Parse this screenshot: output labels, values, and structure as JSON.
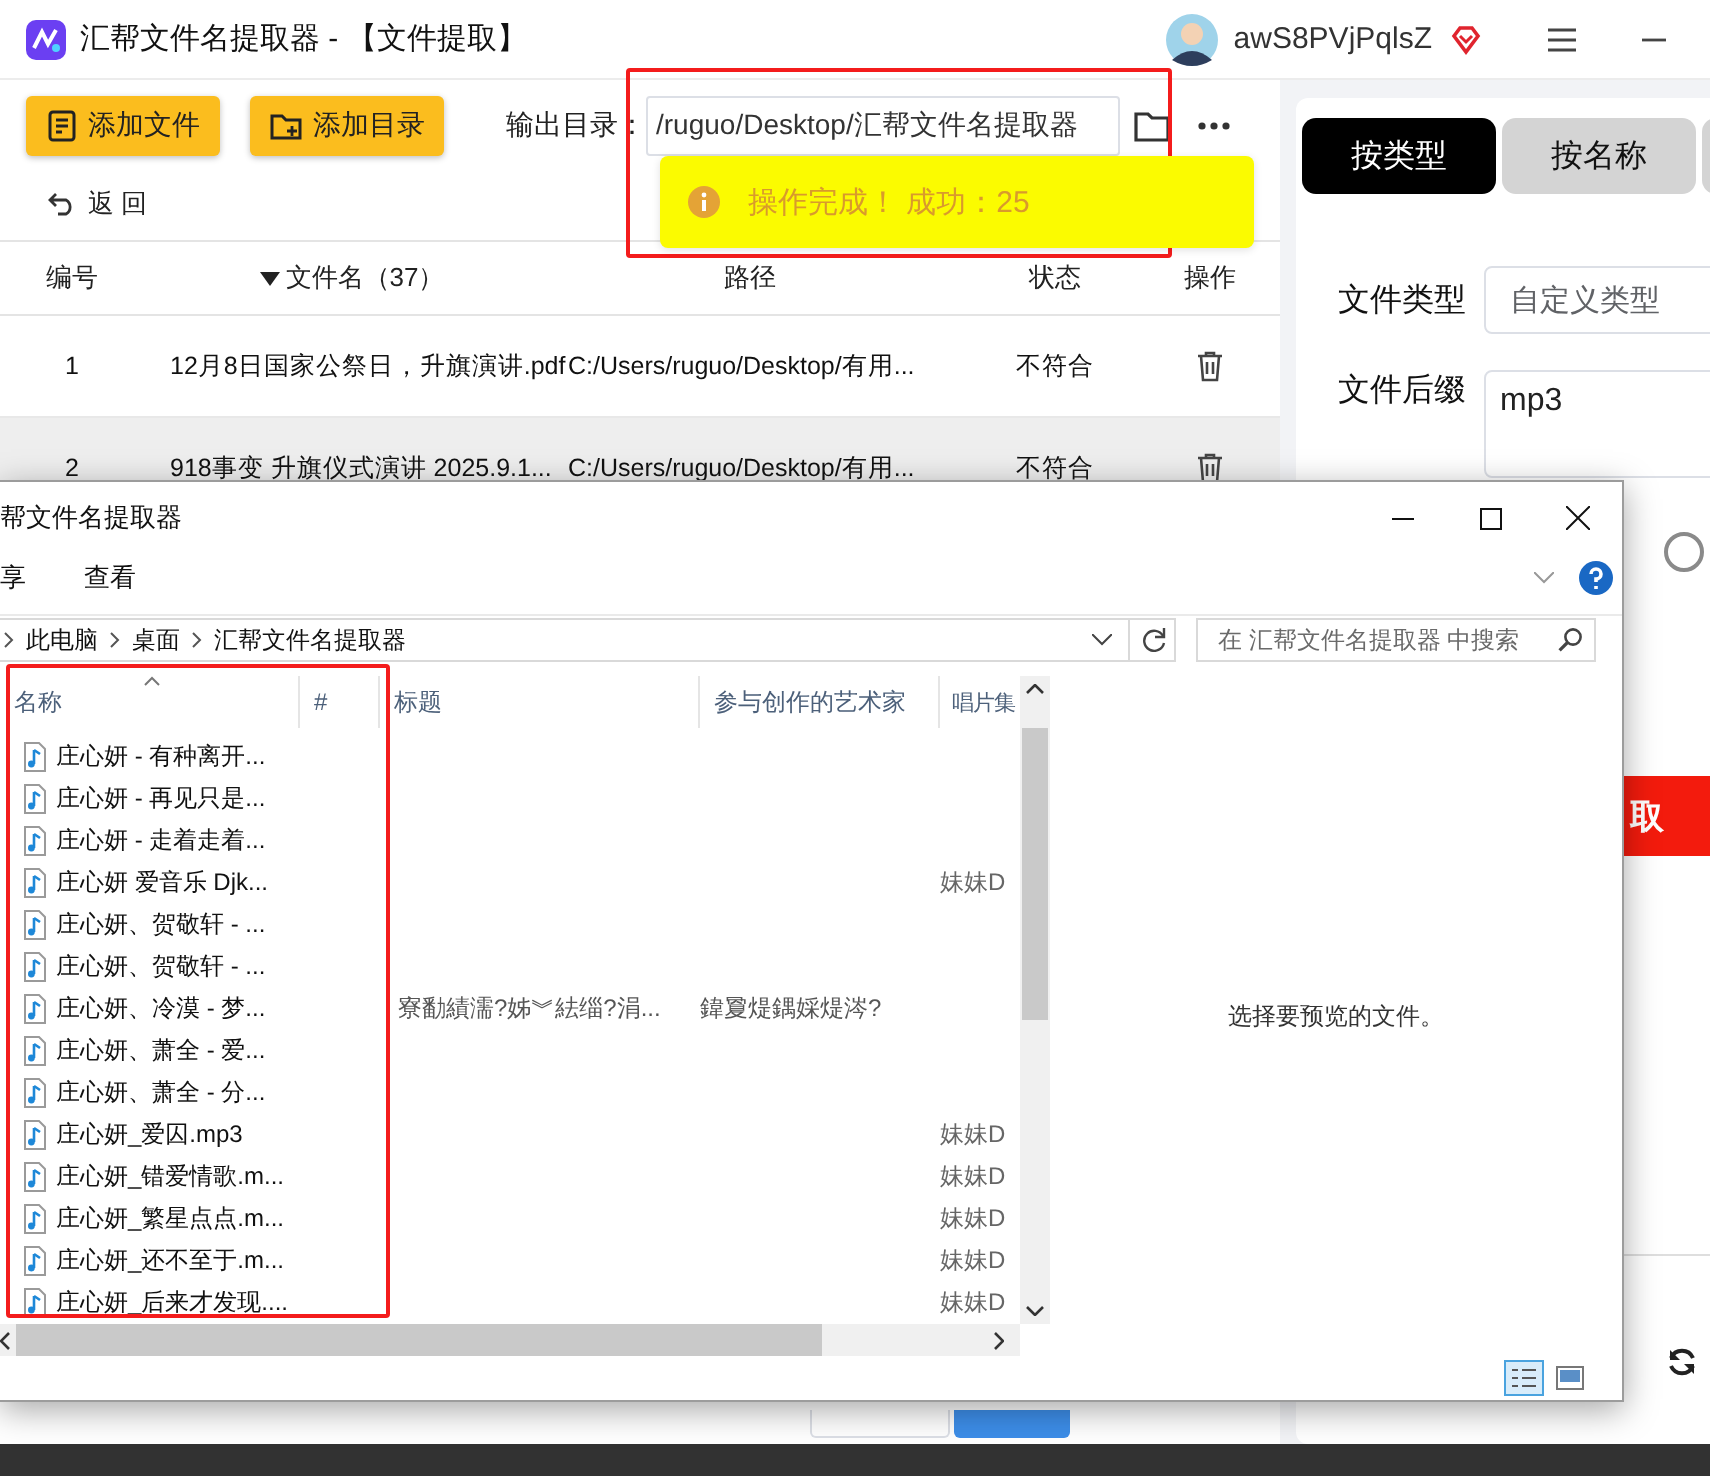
{
  "app": {
    "title": "汇帮文件名提取器 - 【文件提取】",
    "username": "awS8PVjPqlsZ"
  },
  "toolbar": {
    "buttons": [
      {
        "label": "添加文件",
        "kind": "file"
      },
      {
        "label": "添加目录",
        "kind": "folder"
      }
    ],
    "output_label": "输出目录：",
    "output_path": "/ruguo/Desktop/汇帮文件名提取器",
    "back": "返 回"
  },
  "table": {
    "columns": [
      {
        "label": "编号",
        "sorted": false
      },
      {
        "label": "文件名（37）",
        "sorted": true
      },
      {
        "label": "路径",
        "sorted": false
      },
      {
        "label": "状态",
        "sorted": false
      },
      {
        "label": "操作",
        "sorted": false
      }
    ],
    "rows": [
      {
        "number": "1",
        "name": "12月8日国家公祭日，升旗演讲.pdf",
        "path": "C:/Users/ruguo/Desktop/有用...",
        "status": "不符合",
        "selected": false
      },
      {
        "number": "2",
        "name": "918事变 升旗仪式演讲 2025.9.1...",
        "path": "C:/Users/ruguo/Desktop/有用...",
        "status": "不符合",
        "selected": true
      }
    ]
  },
  "side_panel": {
    "tabs": [
      {
        "label": "按类型",
        "selected": true
      },
      {
        "label": "按名称",
        "selected": false
      },
      {
        "selected": false
      }
    ],
    "file_type_label": "文件类型",
    "file_type_value": "自定义类型",
    "suffix_label": "文件后缀",
    "suffix_value": "mp3",
    "option_checked": false,
    "action_button": "取"
  },
  "toast": {
    "text": "操作完成！ 成功：25"
  },
  "explorer": {
    "title": "帮文件名提取器",
    "ribbon_tabs": [
      "享",
      "查看"
    ],
    "breadcrumb": [
      "此电脑",
      "桌面",
      "汇帮文件名提取器"
    ],
    "search_placeholder": "在 汇帮文件名提取器 中搜索",
    "columns": [
      {
        "label": "名称",
        "sorted": true
      },
      {
        "label": "#",
        "sorted": false
      },
      {
        "label": "标题",
        "sorted": false
      },
      {
        "label": "参与创作的艺术家",
        "sorted": false
      },
      {
        "label": "唱片集",
        "sorted": false
      }
    ],
    "files": [
      {
        "name": "庄心妍 - 有种离开..."
      },
      {
        "name": "庄心妍 - 再见只是..."
      },
      {
        "name": "庄心妍 - 走着走着..."
      },
      {
        "name": "庄心妍 爱音乐 Djk...",
        "album": "妹妹D"
      },
      {
        "name": "庄心妍、贺敬轩 - ..."
      },
      {
        "name": "庄心妍、贺敬轩 - ..."
      },
      {
        "name": "庄心妍、冷漠 - 梦...",
        "title": "寮勫績濡?姊︾紶缁?涓...",
        "artist": "鍏夐煶鍝婇煶涔?"
      },
      {
        "name": "庄心妍、萧全 - 爱..."
      },
      {
        "name": "庄心妍、萧全 - 分..."
      },
      {
        "name": "庄心妍_爱囚.mp3",
        "album": "妹妹D"
      },
      {
        "name": "庄心妍_错爱情歌.m...",
        "album": "妹妹D"
      },
      {
        "name": "庄心妍_繁星点点.m...",
        "album": "妹妹D"
      },
      {
        "name": "庄心妍_还不至于.m...",
        "album": "妹妹D"
      },
      {
        "name": "庄心妍_后来才发现....",
        "album": "妹妹D"
      }
    ],
    "preview_text": "选择要预览的文件。"
  }
}
